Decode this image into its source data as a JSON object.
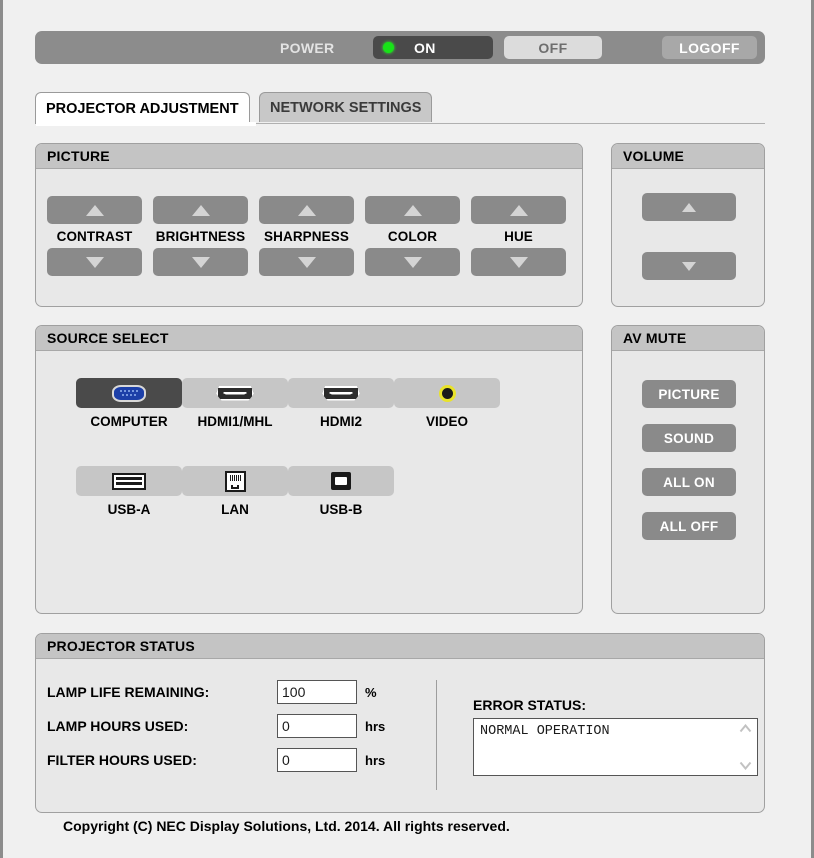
{
  "power_bar": {
    "label": "POWER",
    "on_label": "ON",
    "off_label": "OFF",
    "logoff_label": "LOGOFF",
    "led_color": "#18e218",
    "active": "ON"
  },
  "tabs": [
    {
      "label": "PROJECTOR ADJUSTMENT",
      "active": true
    },
    {
      "label": "NETWORK SETTINGS",
      "active": false
    }
  ],
  "picture": {
    "title": "PICTURE",
    "controls": [
      {
        "label": "CONTRAST"
      },
      {
        "label": "BRIGHTNESS"
      },
      {
        "label": "SHARPNESS"
      },
      {
        "label": "COLOR"
      },
      {
        "label": "HUE"
      }
    ]
  },
  "volume": {
    "title": "VOLUME"
  },
  "source_select": {
    "title": "SOURCE SELECT",
    "selected": "COMPUTER",
    "items": [
      {
        "label": "COMPUTER",
        "icon": "vga-connector-icon"
      },
      {
        "label": "HDMI1/MHL",
        "icon": "hdmi-connector-icon"
      },
      {
        "label": "HDMI2",
        "icon": "hdmi-connector-icon"
      },
      {
        "label": "VIDEO",
        "icon": "rca-jack-icon"
      },
      {
        "label": "USB-A",
        "icon": "usb-a-connector-icon"
      },
      {
        "label": "LAN",
        "icon": "rj45-connector-icon"
      },
      {
        "label": "USB-B",
        "icon": "usb-b-connector-icon"
      }
    ]
  },
  "av_mute": {
    "title": "AV MUTE",
    "buttons": [
      {
        "label": "PICTURE"
      },
      {
        "label": "SOUND"
      },
      {
        "label": "ALL ON"
      },
      {
        "label": "ALL OFF"
      }
    ]
  },
  "projector_status": {
    "title": "PROJECTOR STATUS",
    "fields": [
      {
        "label": "LAMP LIFE REMAINING:",
        "value": "100",
        "unit": "%"
      },
      {
        "label": "LAMP HOURS USED:",
        "value": "0",
        "unit": "hrs"
      },
      {
        "label": "FILTER HOURS USED:",
        "value": "0",
        "unit": "hrs"
      }
    ],
    "error_status_label": "ERROR STATUS:",
    "error_status_text": "NORMAL OPERATION"
  },
  "footer": {
    "copyright": "Copyright (C) NEC Display Solutions, Ltd. 2014. All rights reserved."
  }
}
